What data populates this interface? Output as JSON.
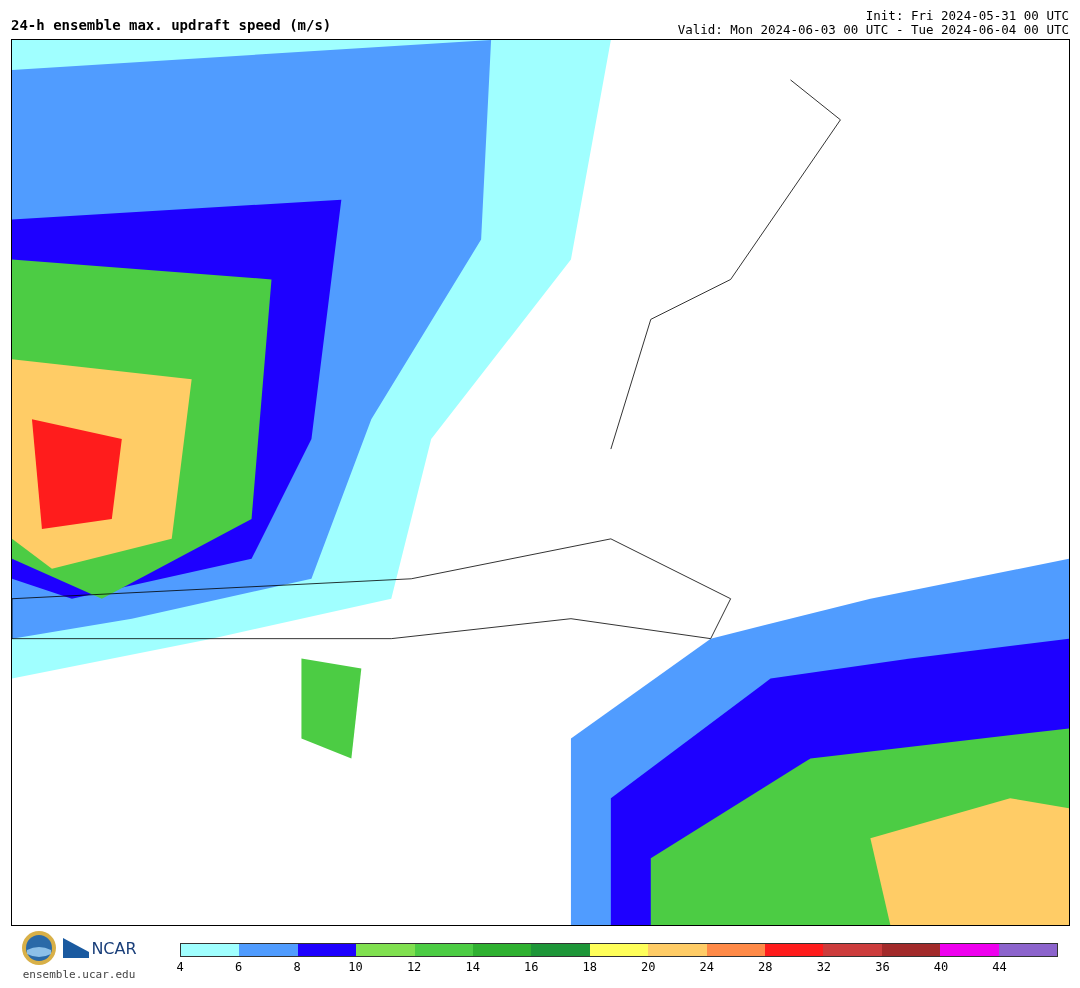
{
  "title": "24-h ensemble max. updraft speed (m/s)",
  "init": "Init: Fri 2024-05-31 00 UTC",
  "valid": "Valid: Mon 2024-06-03 00 UTC - Tue 2024-06-04 00 UTC",
  "footer": {
    "logo_text": "NCAR",
    "site": "ensemble.ucar.edu"
  },
  "colorbar": {
    "bins": [
      {
        "color": "#a0ffff"
      },
      {
        "color": "#509cff"
      },
      {
        "color": "#1e00ff"
      },
      {
        "color": "#80e050"
      },
      {
        "color": "#4ccc44"
      },
      {
        "color": "#2fb030"
      },
      {
        "color": "#1e9638"
      },
      {
        "color": "#ffff5a"
      },
      {
        "color": "#ffcc66"
      },
      {
        "color": "#ff8a48"
      },
      {
        "color": "#ff1c1c"
      },
      {
        "color": "#cc3c3c"
      },
      {
        "color": "#a22a2a"
      },
      {
        "color": "#ee00ee"
      },
      {
        "color": "#8c64cc"
      }
    ],
    "ticks": [
      "4",
      "6",
      "8",
      "10",
      "12",
      "14",
      "16",
      "18",
      "20",
      "24",
      "28",
      "32",
      "36",
      "40",
      "44"
    ]
  }
}
